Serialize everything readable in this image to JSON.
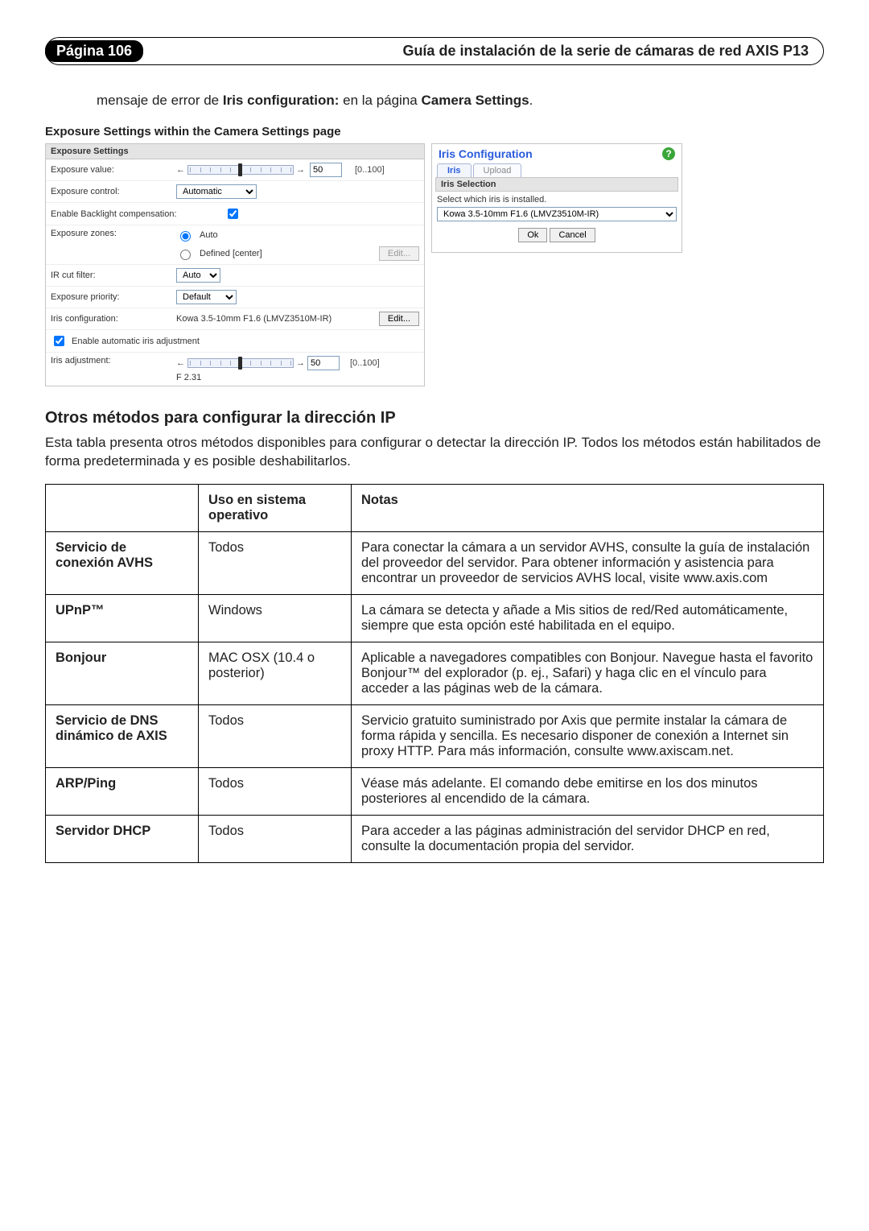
{
  "header": {
    "page_label": "Página 106",
    "doc_title": "Guía de instalación de la serie de cámaras de red AXIS P13"
  },
  "intro": {
    "prefix": "mensaje de error de ",
    "bold1": "Iris configuration:",
    "mid": " en la página ",
    "bold2": "Camera Settings",
    "suffix": "."
  },
  "caption": "Exposure Settings within the Camera Settings page",
  "exposure": {
    "title": "Exposure Settings",
    "rows": {
      "value_label": "Exposure value:",
      "value_num": "50",
      "value_range": "[0..100]",
      "control_label": "Exposure control:",
      "control_sel": "Automatic",
      "backlight_label": "Enable Backlight compensation:",
      "zones_label": "Exposure zones:",
      "zones_auto": "Auto",
      "zones_defined": "Defined [center]",
      "zones_edit": "Edit...",
      "ircut_label": "IR cut filter:",
      "ircut_sel": "Auto",
      "priority_label": "Exposure priority:",
      "priority_sel": "Default",
      "iriscfg_label": "Iris configuration:",
      "iriscfg_val": "Kowa 3.5-10mm F1.6 (LMVZ3510M-IR)",
      "iriscfg_edit": "Edit...",
      "autoiris_label": "Enable automatic iris adjustment",
      "irisadj_label": "Iris adjustment:",
      "irisadj_num": "50",
      "irisadj_range": "[0..100]",
      "irisadj_f": "F 2.31"
    }
  },
  "iris": {
    "title": "Iris Configuration",
    "tab1": "Iris",
    "tab2": "Upload",
    "selection_hdr": "Iris Selection",
    "select_text": "Select which iris is installed.",
    "option": "Kowa 3.5-10mm F1.6 (LMVZ3510M-IR)",
    "ok": "Ok",
    "cancel": "Cancel"
  },
  "section": {
    "title": "Otros métodos para configurar la dirección IP",
    "para": "Esta tabla presenta otros métodos disponibles para configurar o detectar la dirección IP. Todos los métodos están habilitados de forma predeterminada y es posible deshabilitarlos."
  },
  "table": {
    "headers": {
      "os": "Uso en sistema operativo",
      "notes": "Notas"
    },
    "rows": [
      {
        "name": "Servicio de conexión AVHS",
        "os": "Todos",
        "notes": "Para conectar la cámara a un servidor AVHS, consulte la guía de instalación del proveedor del servidor. Para obtener información y asistencia para encontrar un proveedor de servicios AVHS local, visite www.axis.com"
      },
      {
        "name": "UPnP™",
        "os": "Windows",
        "notes": "La cámara se detecta y añade a Mis sitios de red/Red automáticamente, siempre que esta opción esté habilitada en el equipo."
      },
      {
        "name": "Bonjour",
        "os": "MAC OSX (10.4 o posterior)",
        "notes": "Aplicable a navegadores compatibles con Bonjour. Navegue hasta el favorito Bonjour™ del explorador (p. ej., Safari) y haga clic en el vínculo para acceder a las páginas web de la cámara."
      },
      {
        "name": "Servicio de DNS dinámico de AXIS",
        "os": "Todos",
        "notes": "Servicio gratuito suministrado por Axis que permite instalar la cámara de forma rápida y sencilla. Es necesario disponer de conexión a Internet sin proxy HTTP. Para más información, consulte www.axiscam.net."
      },
      {
        "name": "ARP/Ping",
        "os": "Todos",
        "notes": "Véase más adelante. El comando debe emitirse en los dos minutos posteriores al encendido de la cámara."
      },
      {
        "name": "Servidor DHCP",
        "os": "Todos",
        "notes": "Para acceder a las páginas administración del servidor DHCP en red, consulte la documentación propia del servidor."
      }
    ]
  }
}
